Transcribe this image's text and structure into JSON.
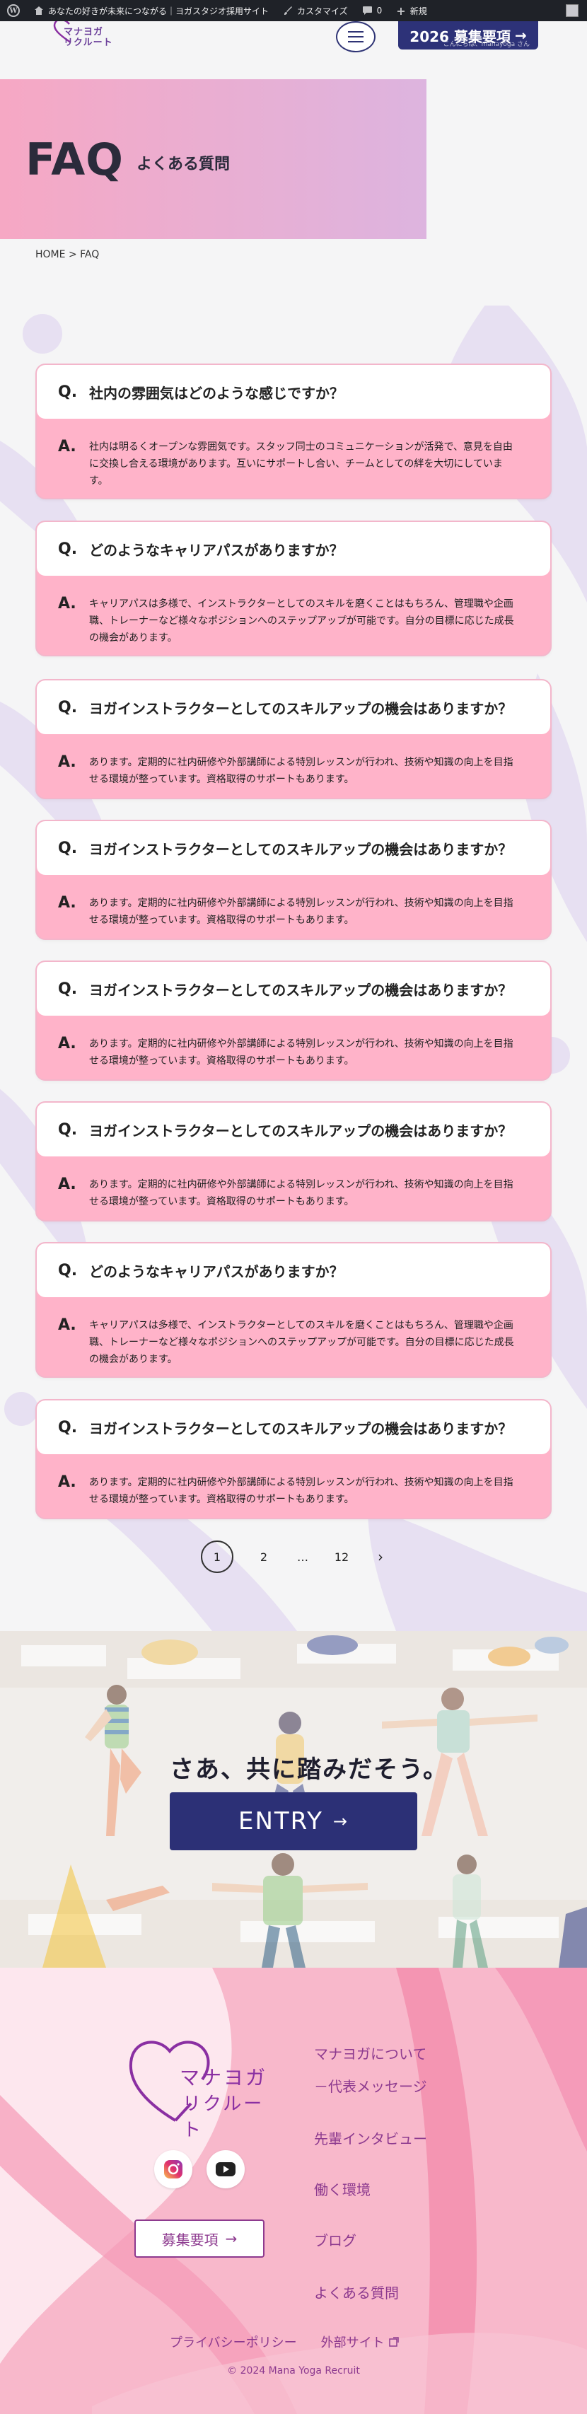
{
  "admin_bar": {
    "site_name": "あなたの好きが未来につながる｜ヨガスタジオ採用サイト",
    "customize": "カスタマイズ",
    "comments_count": "0",
    "new_label": "新規",
    "howdy": "こんにちは、manayoga さん"
  },
  "header": {
    "logo_line1": "マナヨガ",
    "logo_line2": "リクルート",
    "recruit_button": "2026 募集要項",
    "recruit_arrow": "→"
  },
  "hero": {
    "title": "FAQ",
    "subtitle": "よくある質問"
  },
  "breadcrumb": {
    "home": "HOME",
    "separator": ">",
    "current": "FAQ"
  },
  "faq": {
    "q_mark": "Q.",
    "a_mark": "A.",
    "items": [
      {
        "question": "社内の雰囲気はどのような感じですか？",
        "answer": "社内は明るくオープンな雰囲気です。スタッフ同士のコミュニケーションが活発で、意見を自由に交換し合える環境があります。互いにサポートし合い、チームとしての絆を大切にしています。"
      },
      {
        "question": "どのようなキャリアパスがありますか？",
        "answer": "キャリアパスは多様で、インストラクターとしてのスキルを磨くことはもちろん、管理職や企画職、トレーナーなど様々なポジションへのステップアップが可能です。自分の目標に応じた成長の機会があります。"
      },
      {
        "question": "ヨガインストラクターとしてのスキルアップの機会はありますか？",
        "answer": "あります。定期的に社内研修や外部講師による特別レッスンが行われ、技術や知識の向上を目指せる環境が整っています。資格取得のサポートもあります。"
      },
      {
        "question": "ヨガインストラクターとしてのスキルアップの機会はありますか？",
        "answer": "あります。定期的に社内研修や外部講師による特別レッスンが行われ、技術や知識の向上を目指せる環境が整っています。資格取得のサポートもあります。"
      },
      {
        "question": "ヨガインストラクターとしてのスキルアップの機会はありますか？",
        "answer": "あります。定期的に社内研修や外部講師による特別レッスンが行われ、技術や知識の向上を目指せる環境が整っています。資格取得のサポートもあります。"
      },
      {
        "question": "ヨガインストラクターとしてのスキルアップの機会はありますか？",
        "answer": "あります。定期的に社内研修や外部講師による特別レッスンが行われ、技術や知識の向上を目指せる環境が整っています。資格取得のサポートもあります。"
      },
      {
        "question": "どのようなキャリアパスがありますか？",
        "answer": "キャリアパスは多様で、インストラクターとしてのスキルを磨くことはもちろん、管理職や企画職、トレーナーなど様々なポジションへのステップアップが可能です。自分の目標に応じた成長の機会があります。"
      },
      {
        "question": "ヨガインストラクターとしてのスキルアップの機会はありますか？",
        "answer": "あります。定期的に社内研修や外部講師による特別レッスンが行われ、技術や知識の向上を目指せる環境が整っています。資格取得のサポートもあります。"
      }
    ]
  },
  "pagination": {
    "pages": [
      "1",
      "2",
      "…",
      "12"
    ],
    "next": "›"
  },
  "entry": {
    "title": "さあ、共に踏みだそう。",
    "button": "ENTRY",
    "arrow": "→"
  },
  "footer": {
    "logo_line1": "マナヨガ",
    "logo_line2": "リクルート",
    "recruit_button": "募集要項",
    "recruit_arrow": "→",
    "nav": [
      "マナヨガについて",
      "－代表メッセージ",
      "先輩インタビュー",
      "働く環境",
      "ブログ",
      "よくある質問"
    ],
    "privacy": "プライバシーポリシー",
    "external": "外部サイト",
    "copyright": "© 2024 Mana Yoga Recruit"
  },
  "colors": {
    "navy": "#2d3278",
    "pink": "#ffb3c9",
    "purple": "#8d3a8f"
  }
}
